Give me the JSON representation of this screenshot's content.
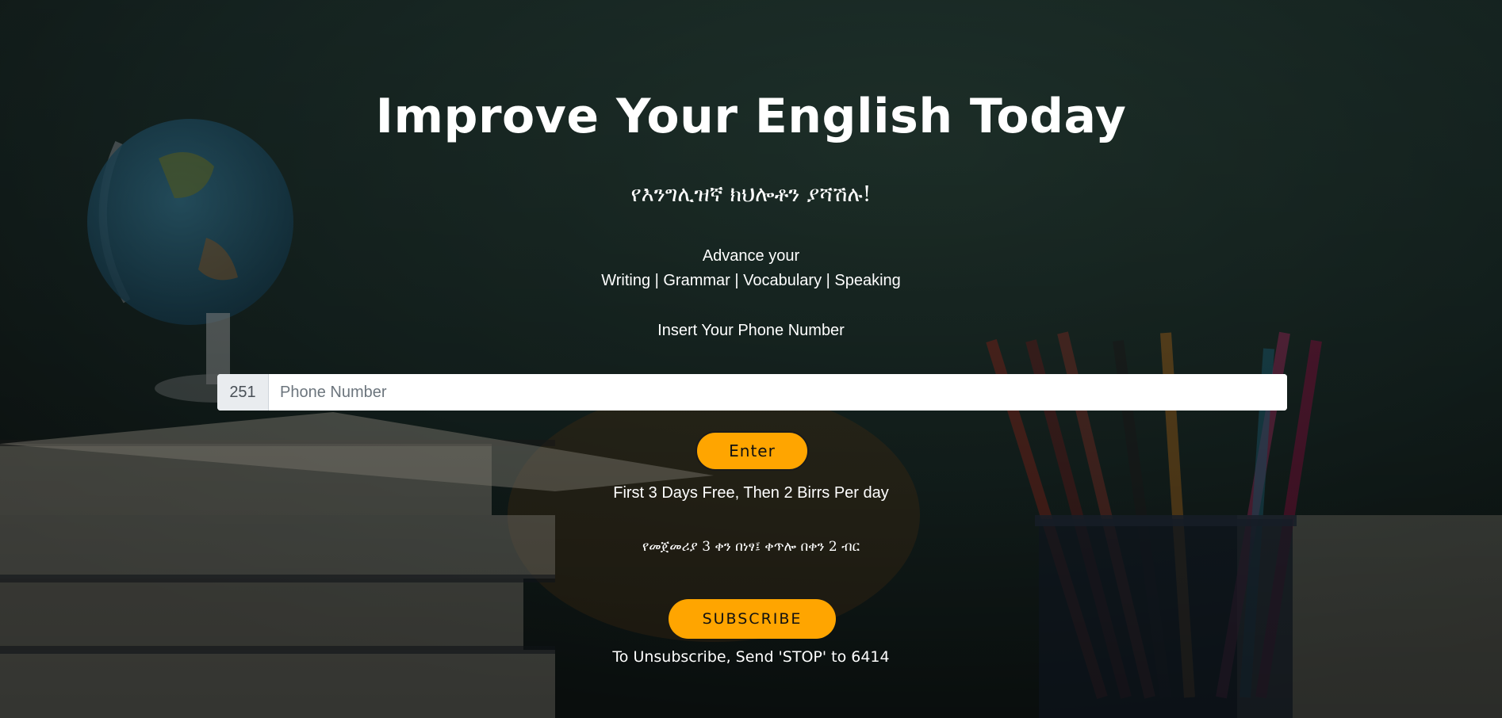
{
  "hero": {
    "title": "Improve Your English Today",
    "subtitle_amharic": "የእንግሊዝኛ ክህሎቶን ያሻሽሉ!",
    "advance_line1": "Advance your",
    "advance_line2": "Writing | Grammar | Vocabulary | Speaking"
  },
  "form": {
    "phone_label": "Insert Your Phone Number",
    "country_code": "251",
    "phone_placeholder": "Phone Number",
    "phone_value": "",
    "enter_label": "Enter"
  },
  "pricing": {
    "english": "First 3 Days Free, Then 2 Birrs Per day",
    "amharic": "የመጀመሪያ 3 ቀን በነፃ፤ ቀጥሎ በቀን 2 ብር"
  },
  "subscribe": {
    "button_label": "SUBSCRIBE",
    "unsubscribe_text": "To Unsubscribe, Send 'STOP' to 6414"
  },
  "background": {
    "description_icons": [
      "globe-icon",
      "books-icon",
      "pencil-cup-icon"
    ]
  },
  "colors": {
    "accent": "#ffa500",
    "overlay": "#1d2a26",
    "text": "#ffffff"
  }
}
